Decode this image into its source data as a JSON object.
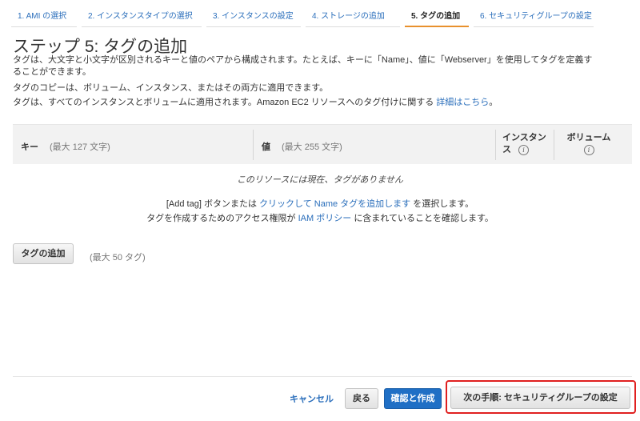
{
  "wizard_steps": [
    {
      "label": "1. AMI の選択"
    },
    {
      "label": "2. インスタンスタイプの選択"
    },
    {
      "label": "3. インスタンスの設定"
    },
    {
      "label": "4. ストレージの追加"
    },
    {
      "label": "5. タグの追加"
    },
    {
      "label": "6. セキュリティグループの設定"
    }
  ],
  "page": {
    "title": "ステップ 5: タグの追加",
    "desc_line1": "タグは、大文字と小文字が区別されるキーと値のペアから構成されます。たとえば、キーに「Name」、値に「Webserver」を使用してタグを定義す",
    "desc_line2": "ることができます。",
    "desc_line3": "タグのコピーは、ボリューム、インスタンス、またはその両方に適用できます。",
    "desc_line4_prefix": "タグは、すべてのインスタンスとボリュームに適用されます。Amazon EC2 リソースへのタグ付けに関する",
    "desc_line4_link": "詳細はこちら",
    "desc_line4_suffix": "。"
  },
  "table": {
    "col_key": "キー",
    "col_key_hint": "(最大 127 文字)",
    "col_value": "値",
    "col_value_hint": "(最大 255 文字)",
    "col_instances_l1": "インスタン",
    "col_instances_l2": "ス",
    "col_volumes": "ボリューム",
    "info_glyph": "i",
    "empty_message": "このリソースには現在、タグがありません"
  },
  "hints": {
    "line1_prefix": "[Add tag] ボタンまたは",
    "line1_link": "クリックして Name タグを追加します",
    "line1_suffix": "を選択します。",
    "line2_prefix": "タグを作成するためのアクセス権限が",
    "line2_link": "IAM ポリシー",
    "line2_suffix": "に含まれていることを確認します。"
  },
  "actions": {
    "add_tag_label": "タグの追加",
    "tag_limit": "(最大 50 タグ)",
    "cancel_label": "キャンセル",
    "back_label": "戻る",
    "review_launch_label": "確認と作成",
    "next_label": "次の手順: セキュリティグループの設定"
  },
  "colors": {
    "link": "#2a6ebb",
    "active_step_underline": "#e8912d",
    "primary_button": "#1f6fc5",
    "highlight_border": "#e02020"
  }
}
